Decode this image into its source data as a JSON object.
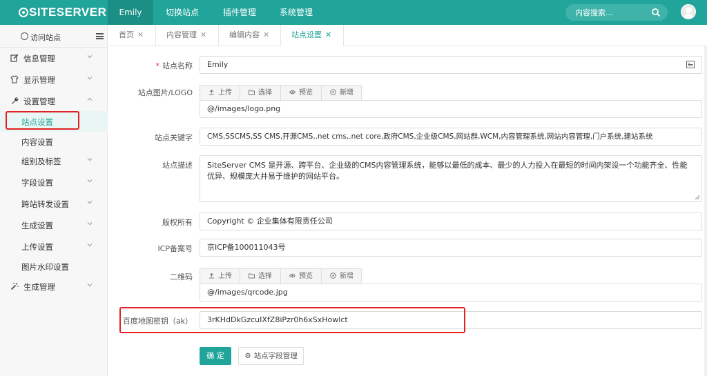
{
  "app": {
    "logo": "SITESERVER"
  },
  "topnav": {
    "items": [
      {
        "label": "Emily",
        "active": true
      },
      {
        "label": "切换站点",
        "active": false
      },
      {
        "label": "插件管理",
        "active": false
      },
      {
        "label": "系统管理",
        "active": false
      }
    ],
    "search_placeholder": "内容搜索..."
  },
  "sidebar": {
    "visit_label": "访问站点",
    "items": [
      {
        "label": "信息管理",
        "icon": "edit-icon",
        "chevron": "down"
      },
      {
        "label": "显示管理",
        "icon": "shirt-icon",
        "chevron": "down"
      },
      {
        "label": "设置管理",
        "icon": "wrench-icon",
        "chevron": "up"
      },
      {
        "label": "站点设置",
        "selected": true
      },
      {
        "label": "内容设置"
      },
      {
        "label": "组别及标签",
        "chevron": "down"
      },
      {
        "label": "字段设置",
        "chevron": "down"
      },
      {
        "label": "跨站转发设置",
        "chevron": "down"
      },
      {
        "label": "生成设置",
        "chevron": "down"
      },
      {
        "label": "上传设置",
        "chevron": "down"
      },
      {
        "label": "图片水印设置"
      },
      {
        "label": "生成管理",
        "icon": "magic-wand-icon",
        "chevron": "down"
      }
    ]
  },
  "tabs": [
    {
      "label": "首页",
      "active": false
    },
    {
      "label": "内容管理",
      "active": false
    },
    {
      "label": "编辑内容",
      "active": false
    },
    {
      "label": "站点设置",
      "active": true
    }
  ],
  "form": {
    "site_name": {
      "label": "站点名称",
      "value": "Emily"
    },
    "site_logo": {
      "label": "站点图片/LOGO",
      "value": "@/images/logo.png"
    },
    "upload_toolbar": {
      "upload": "上传",
      "select": "选择",
      "preview": "预览",
      "add": "新增"
    },
    "keywords": {
      "label": "站点关键字",
      "value": "CMS,SSCMS,SS CMS,开源CMS,.net cms,.net core,政府CMS,企业级CMS,网站群,WCM,内容管理系统,网站内容管理,门户系统,建站系统"
    },
    "description": {
      "label": "站点描述",
      "value": "SiteServer CMS 是开源、跨平台、企业级的CMS内容管理系统，能够以最低的成本、最少的人力投入在最短的时间内架设一个功能齐全、性能优异、规模庞大并易于维护的网站平台。"
    },
    "copyright": {
      "label": "版权所有",
      "value": "Copyright © 企业集体有限责任公司"
    },
    "icp": {
      "label": "ICP备案号",
      "value": "京ICP备100011043号"
    },
    "qrcode": {
      "label": "二维码",
      "value": "@/images/qrcode.jpg"
    },
    "baidu_ak": {
      "label": "百度地图密钥（ak）",
      "value": "3rKHdDkGzcuIXfZ8iPzr0h6xSxHowlct"
    },
    "confirm_label": "确 定",
    "fields_label": "站点字段管理"
  },
  "colors": {
    "brand": "#21a59a",
    "highlight": "#e32024"
  }
}
